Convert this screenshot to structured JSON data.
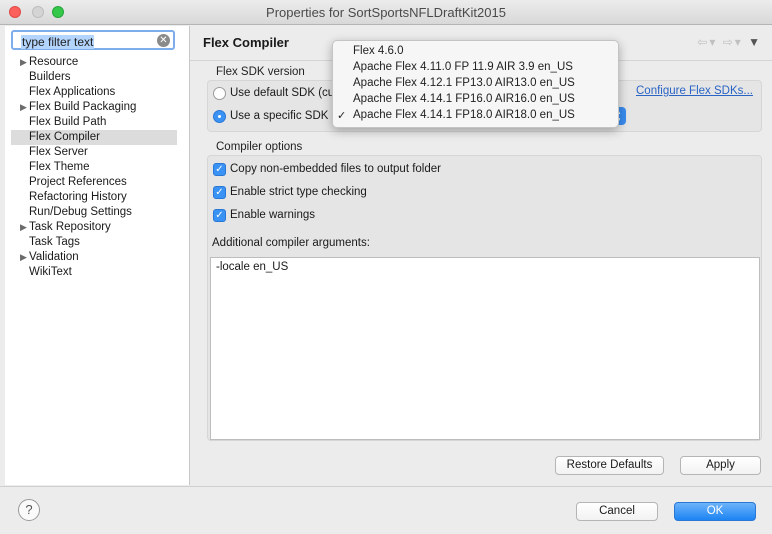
{
  "window": {
    "title": "Properties for SortSportsNFLDraftKit2015"
  },
  "filter": {
    "value": "type filter text"
  },
  "tree": [
    {
      "label": "Resource",
      "expandable": true
    },
    {
      "label": "Builders",
      "expandable": false
    },
    {
      "label": "Flex Applications",
      "expandable": false
    },
    {
      "label": "Flex Build Packaging",
      "expandable": true
    },
    {
      "label": "Flex Build Path",
      "expandable": false
    },
    {
      "label": "Flex Compiler",
      "expandable": false,
      "selected": true
    },
    {
      "label": "Flex Server",
      "expandable": false
    },
    {
      "label": "Flex Theme",
      "expandable": false
    },
    {
      "label": "Project References",
      "expandable": false
    },
    {
      "label": "Refactoring History",
      "expandable": false
    },
    {
      "label": "Run/Debug Settings",
      "expandable": false
    },
    {
      "label": "Task Repository",
      "expandable": true
    },
    {
      "label": "Task Tags",
      "expandable": false
    },
    {
      "label": "Validation",
      "expandable": true
    },
    {
      "label": "WikiText",
      "expandable": false
    }
  ],
  "page": {
    "title": "Flex Compiler"
  },
  "sdk": {
    "section_label": "Flex SDK version",
    "default_label": "Use default SDK (cu",
    "specific_label": "Use a specific SDK",
    "configure_link": "Configure Flex SDKs...",
    "options": [
      {
        "label": "Flex 4.6.0",
        "checked": false
      },
      {
        "label": "Apache Flex 4.11.0 FP 11.9 AIR 3.9 en_US",
        "checked": false
      },
      {
        "label": "Apache Flex 4.12.1 FP13.0 AIR13.0 en_US",
        "checked": false
      },
      {
        "label": "Apache Flex 4.14.1 FP16.0 AIR16.0 en_US",
        "checked": false
      },
      {
        "label": "Apache Flex 4.14.1 FP18.0 AIR18.0 en_US",
        "checked": true
      }
    ]
  },
  "compiler": {
    "section_label": "Compiler options",
    "copy_label": "Copy non-embedded files to output folder",
    "strict_label": "Enable strict type checking",
    "warnings_label": "Enable warnings",
    "args_label": "Additional compiler arguments:",
    "args_value": "-locale en_US"
  },
  "buttons": {
    "restore": "Restore Defaults",
    "apply": "Apply",
    "cancel": "Cancel",
    "ok": "OK"
  },
  "colors": {
    "accent": "#3a93f4",
    "link": "#2a64c5"
  }
}
